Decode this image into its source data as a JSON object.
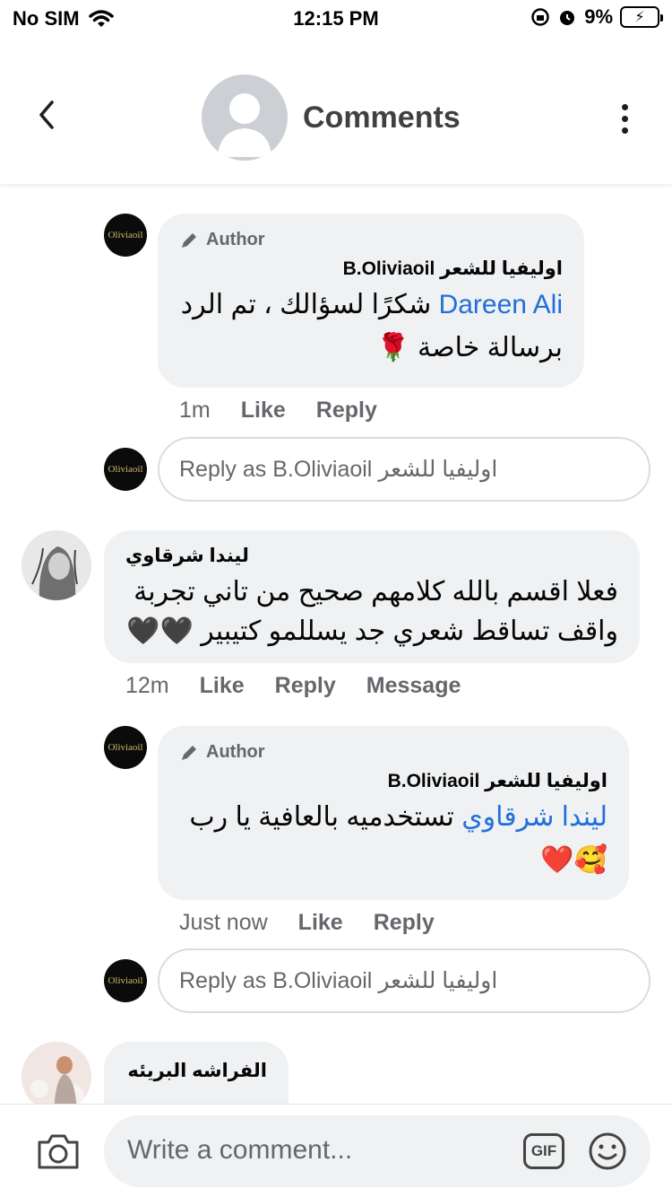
{
  "status": {
    "carrier": "No SIM",
    "time": "12:15 PM",
    "battery": "9%"
  },
  "header": {
    "title": "Comments"
  },
  "comments": [
    {
      "author_tag": "Author",
      "name": "اوليفيا للشعر B.Oliviaoil",
      "mention": "Dareen Ali",
      "text_line1": "شكرًا لسؤالك ، تم الرد",
      "text_line2": "برسالة خاصة 🌹",
      "time": "1m",
      "like": "Like",
      "reply": "Reply",
      "logo_text": "Oliviaoil"
    },
    {
      "name": "ليندا شرقاوي",
      "text_line1": "فعلا اقسم بالله كلامهم صحيح من تاني تجربة",
      "text_line2": "واقف تساقط شعري جد يسللمو كتيبير 🖤🖤",
      "time": "12m",
      "like": "Like",
      "reply": "Reply",
      "message": "Message"
    },
    {
      "author_tag": "Author",
      "name": "اوليفيا للشعر B.Oliviaoil",
      "mention": "ليندا شرقاوي",
      "text_line1": "تستخدميه بالعافية يا رب",
      "text_line2": "🥰❤️",
      "time": "Just now",
      "like": "Like",
      "reply": "Reply",
      "logo_text": "Oliviaoil"
    },
    {
      "name": "الفراشه البريئه"
    }
  ],
  "reply_box": {
    "placeholder": "Reply as B.Oliviaoil اوليفيا للشعر"
  },
  "composer": {
    "placeholder": "Write a comment...",
    "gif_label": "GIF"
  }
}
